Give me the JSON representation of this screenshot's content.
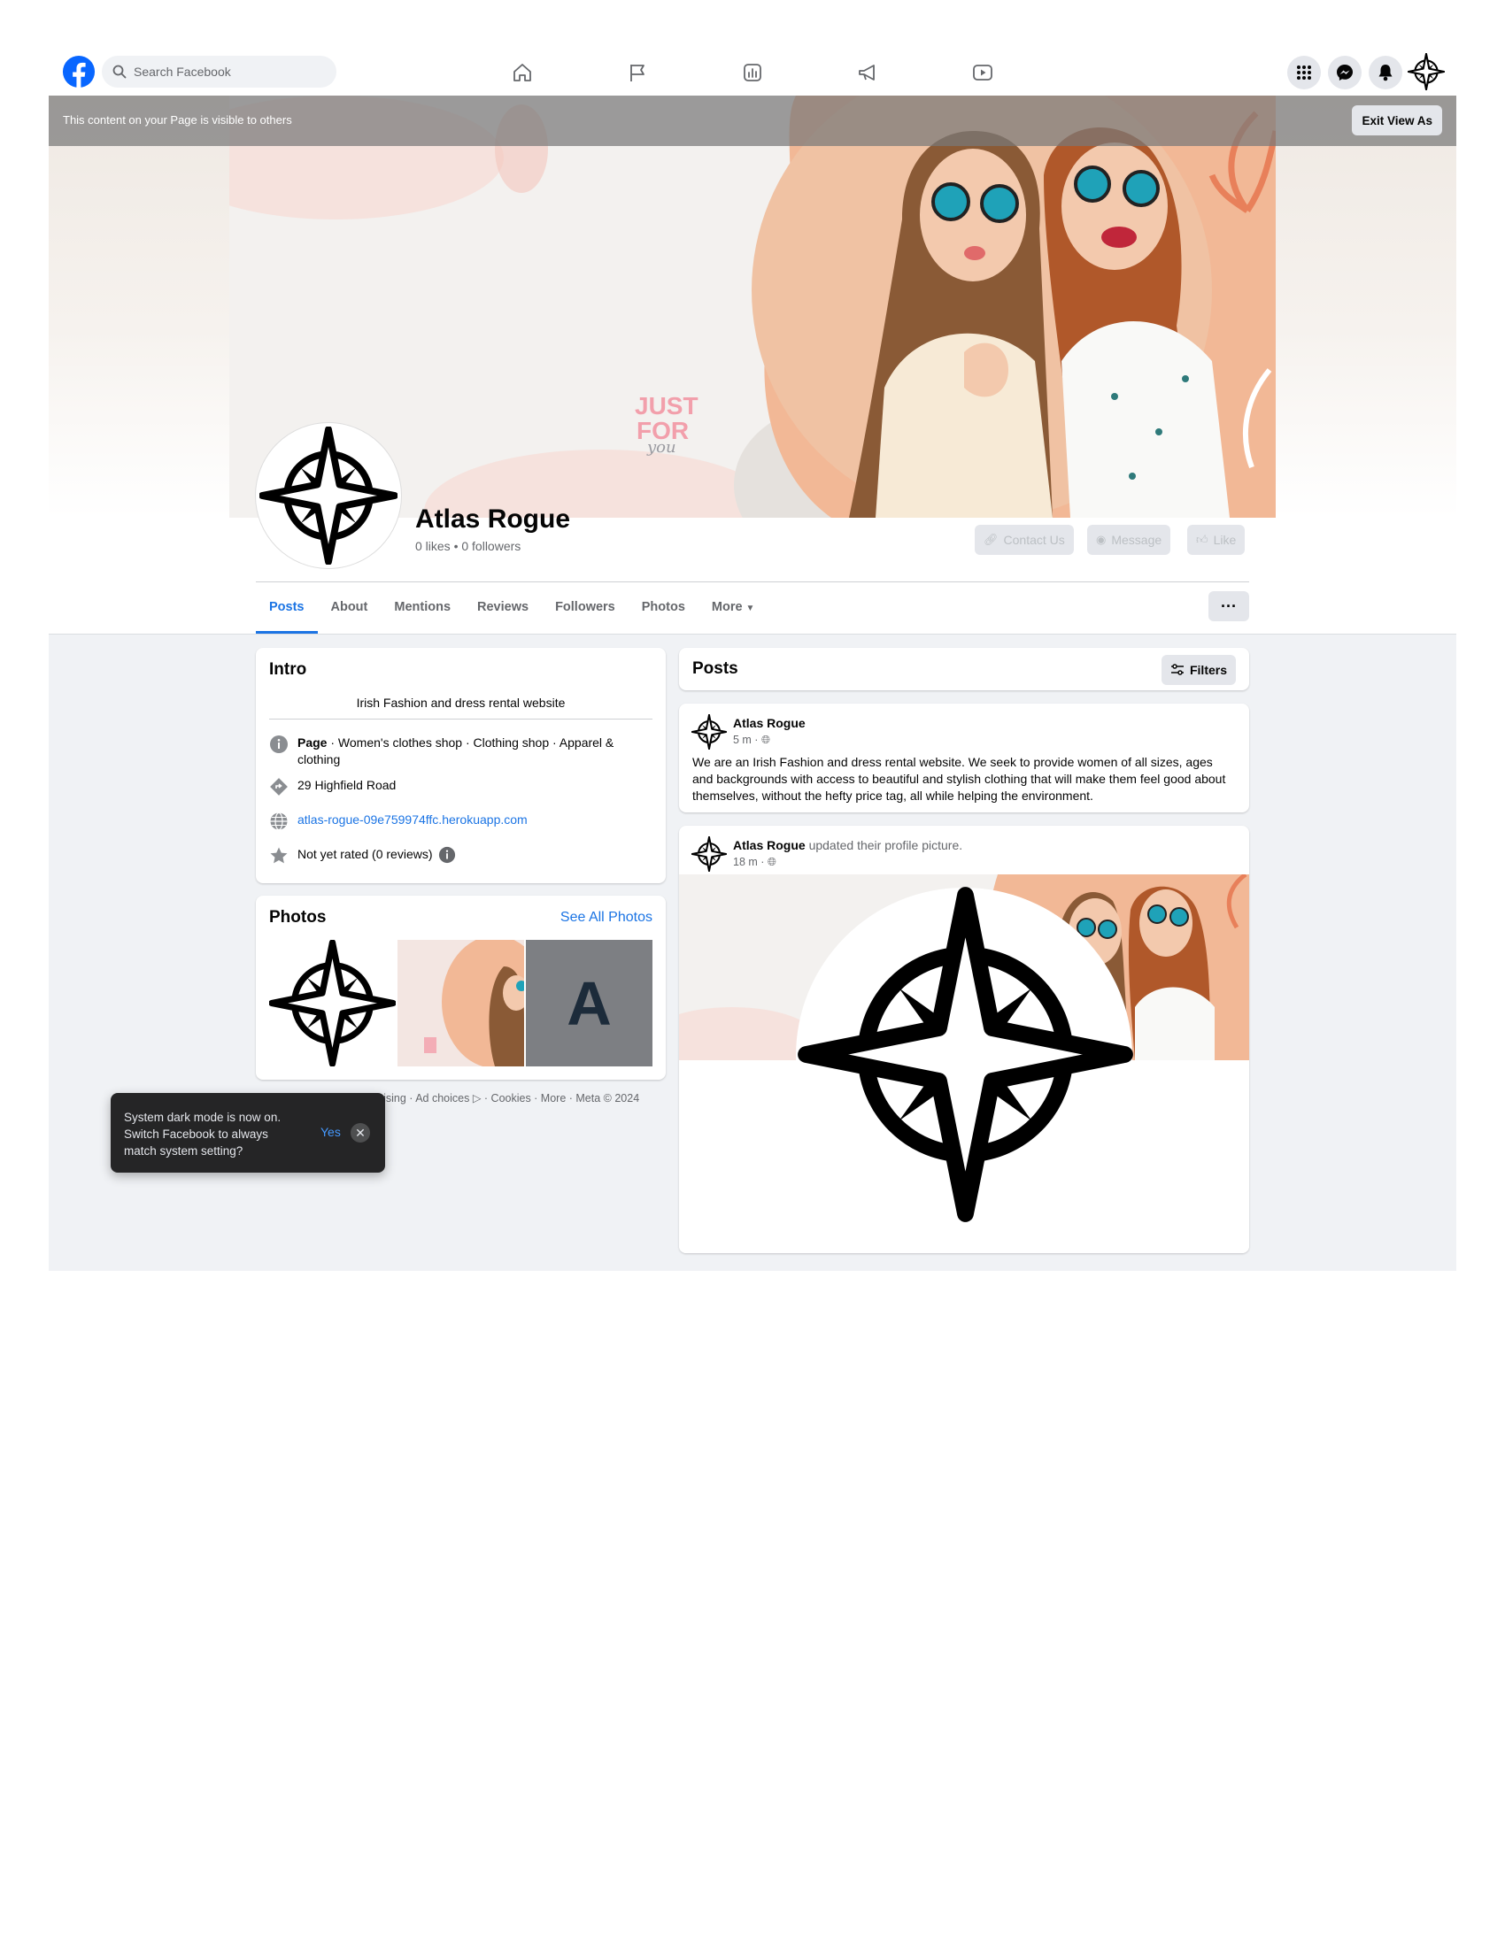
{
  "topnav": {
    "search_placeholder": "Search Facebook",
    "icons": [
      "facebook-logo",
      "home-icon",
      "flag-icon",
      "insights-icon",
      "megaphone-icon",
      "video-icon",
      "menu-grid-icon",
      "messenger-icon",
      "bell-icon"
    ]
  },
  "viewas": {
    "message": "This content on your Page is visible to others",
    "exit_label": "Exit View As"
  },
  "cover": {
    "stamp_line1": "JUST",
    "stamp_line2": "FOR",
    "stamp_line3": "you"
  },
  "profile": {
    "name": "Atlas Rogue",
    "stats": "0 likes • 0 followers",
    "buttons": {
      "contact": "Contact Us",
      "message": "Message",
      "like": "Like"
    }
  },
  "tabs": [
    {
      "label": "Posts"
    },
    {
      "label": "About"
    },
    {
      "label": "Mentions"
    },
    {
      "label": "Reviews"
    },
    {
      "label": "Followers"
    },
    {
      "label": "Photos"
    },
    {
      "label": "More"
    }
  ],
  "intro": {
    "title": "Intro",
    "bio": "Irish Fashion and dress rental website",
    "category_bold": "Page",
    "category_rest": " · Women's clothes shop · Clothing shop · Apparel & clothing",
    "address": "29 Highfield Road",
    "website": "atlas-rogue-09e759974ffc.herokuapp.com",
    "rating": "Not yet rated (0 reviews)"
  },
  "photos": {
    "title": "Photos",
    "see_all": "See All Photos",
    "letter_tile": "A"
  },
  "footer": "· Advertising · Ad choices ▷ · Cookies · More · Meta © 2024",
  "posts": {
    "title": "Posts",
    "filters_label": "Filters",
    "items": [
      {
        "author": "Atlas Rogue",
        "action": "",
        "time": "5 m · ",
        "text": "We are an Irish Fashion and dress rental website. We seek to provide women of all sizes, ages and backgrounds with access to beautiful and stylish clothing that will make them feel good about themselves, without the hefty price tag, all while helping the environment."
      },
      {
        "author": "Atlas Rogue",
        "action": " updated their profile picture.",
        "time": "18 m · "
      }
    ]
  },
  "toast": {
    "text": "System dark mode is now on. Switch Facebook to always match system setting?",
    "yes": "Yes",
    "close": "✕"
  },
  "colors": {
    "accent": "#1b74e4",
    "page_bg": "#f0f2f5",
    "button_bg": "#e4e6eb"
  }
}
